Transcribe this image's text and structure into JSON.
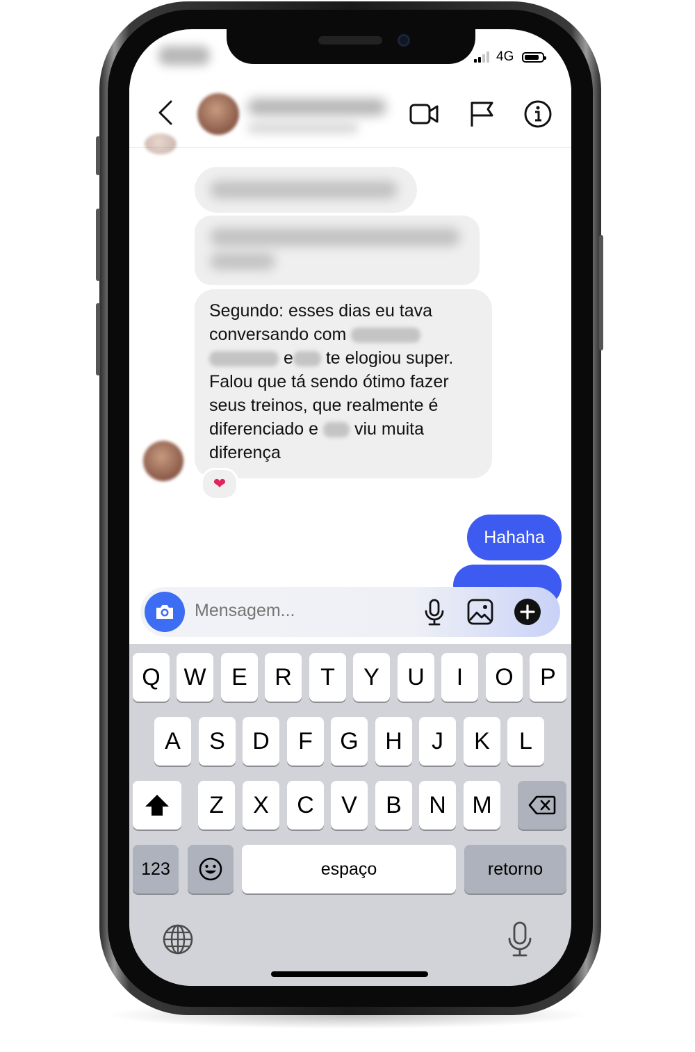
{
  "status_bar": {
    "network": "4G"
  },
  "messages": {
    "received_main": {
      "line1": "Segundo: esses dias eu tava",
      "line2": "conversando com",
      "line3": "e",
      "line3b": "te elogiou super.",
      "line4": "Falou que tá sendo ótimo fazer",
      "line5": "seus treinos, que realmente é",
      "line6a": "diferenciado e",
      "line6b": "viu muita",
      "line7": "diferença"
    },
    "reaction": "❤",
    "sent": [
      {
        "text": "Hahaha"
      }
    ]
  },
  "composer": {
    "placeholder": "Mensagem..."
  },
  "keyboard": {
    "row1": [
      "Q",
      "W",
      "E",
      "R",
      "T",
      "Y",
      "U",
      "I",
      "O",
      "P"
    ],
    "row2": [
      "A",
      "S",
      "D",
      "F",
      "G",
      "H",
      "J",
      "K",
      "L"
    ],
    "row3": [
      "Z",
      "X",
      "C",
      "V",
      "B",
      "N",
      "M"
    ],
    "numbers_label": "123",
    "space_label": "espaço",
    "return_label": "retorno"
  },
  "colors": {
    "accent": "#3d5af1",
    "bubble_in": "#efefef",
    "keyboard_bg": "#d1d3d9"
  },
  "icons": [
    "back-chevron-icon",
    "video-call-icon",
    "flag-icon",
    "info-icon",
    "camera-icon",
    "microphone-icon",
    "image-icon",
    "plus-icon",
    "shift-icon",
    "backspace-icon",
    "emoji-icon",
    "globe-icon",
    "dictation-icon"
  ]
}
